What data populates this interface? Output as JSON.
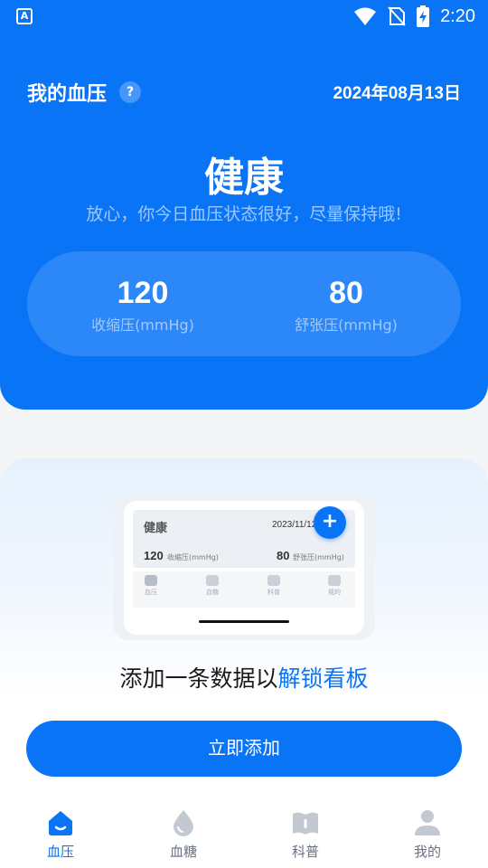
{
  "status_bar": {
    "time": "2:20",
    "app_icon_letter": "A"
  },
  "header": {
    "title": "我的血压",
    "help": "?",
    "date": "2024年08月13日",
    "status_word": "健康",
    "status_desc": "放心，你今日血压状态很好，尽量保持哦!",
    "systolic": {
      "value": "120",
      "label": "收缩压(mmHg)"
    },
    "diastolic": {
      "value": "80",
      "label": "舒张压(mmHg)"
    }
  },
  "preview": {
    "title": "健康",
    "date": "2023/11/12",
    "add_symbol": "+",
    "systolic_value": "120",
    "systolic_label": "收缩压(mmHg)",
    "diastolic_value": "80",
    "diastolic_label": "舒张压(mmHg)",
    "tabs": [
      "血压",
      "血糖",
      "科普",
      "我的"
    ]
  },
  "card": {
    "headline_prefix": "添加一条数据以",
    "headline_highlight": "解锁看板",
    "button_label": "立即添加"
  },
  "nav": {
    "items": [
      {
        "label": "血压",
        "icon": "home-icon",
        "active": true
      },
      {
        "label": "血糖",
        "icon": "drop-icon",
        "active": false
      },
      {
        "label": "科普",
        "icon": "book-icon",
        "active": false
      },
      {
        "label": "我的",
        "icon": "person-icon",
        "active": false
      }
    ]
  },
  "colors": {
    "primary": "#0a74f7",
    "background": "#f3f5f7",
    "nav_inactive": "#6b7280"
  }
}
